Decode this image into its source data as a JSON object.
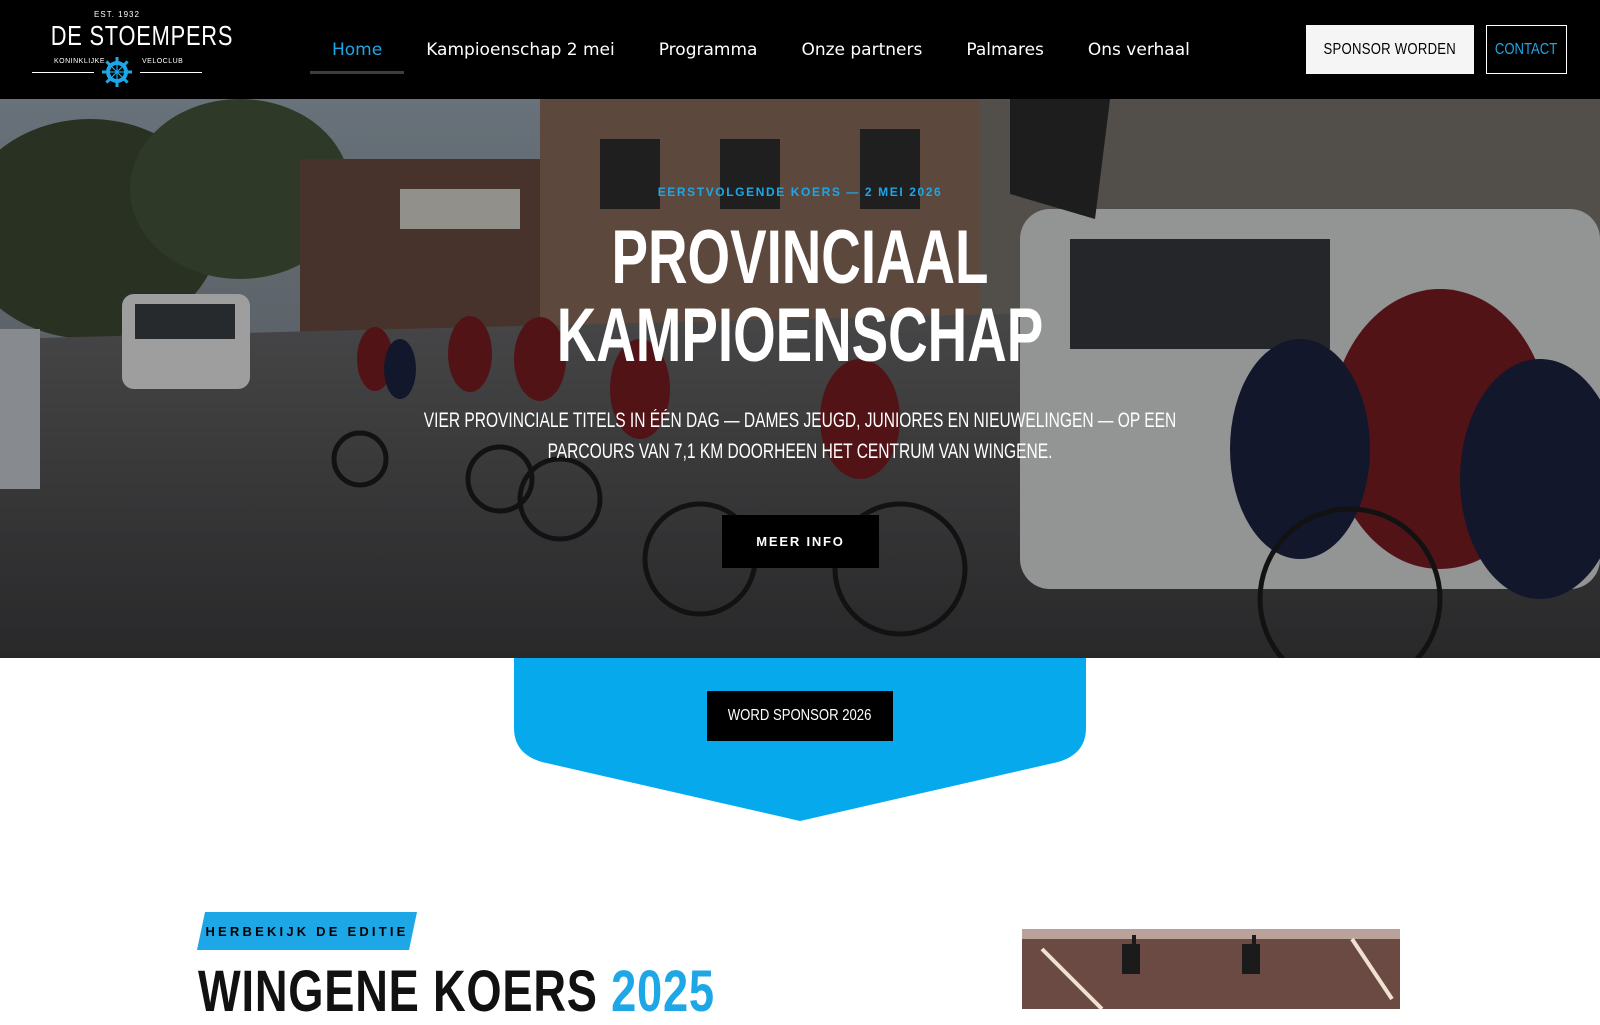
{
  "brand": {
    "est": "EST. 1932",
    "name": "DE STOEMPERS",
    "sub_left": "KONINKLIJKE",
    "sub_right": "VELOCLUB",
    "accent": "#1ea7e6"
  },
  "nav": {
    "items": [
      {
        "label": "Home",
        "active": true
      },
      {
        "label": "Kampioenschap 2 mei",
        "active": false
      },
      {
        "label": "Programma",
        "active": false
      },
      {
        "label": "Onze partners",
        "active": false
      },
      {
        "label": "Palmares",
        "active": false
      },
      {
        "label": "Ons verhaal",
        "active": false
      }
    ]
  },
  "header_actions": {
    "sponsor_label": "SPONSOR WORDEN",
    "contact_label": "CONTACT"
  },
  "hero": {
    "kicker": "EERSTVOLGENDE KOERS — 2 MEI 2026",
    "title_line1": "PROVINCIAAL",
    "title_line2": "KAMPIOENSCHAP",
    "desc_line1": "VIER PROVINCIALE TITELS IN ÉÉN DAG — DAMES JEUGD, JUNIORES EN NIEUWELINGEN — OP EEN",
    "desc_line2": "PARCOURS VAN 7,1 KM DOORHEEN HET CENTRUM VAN WINGENE.",
    "cta_label": "MEER INFO"
  },
  "sponsor_banner": {
    "cta_label": "WORD SPONSOR 2026",
    "color": "#06aaec"
  },
  "edition": {
    "tag": "HERBEKIJK DE EDITIE",
    "title": "WINGENE KOERS ",
    "title_accent": "2025"
  }
}
